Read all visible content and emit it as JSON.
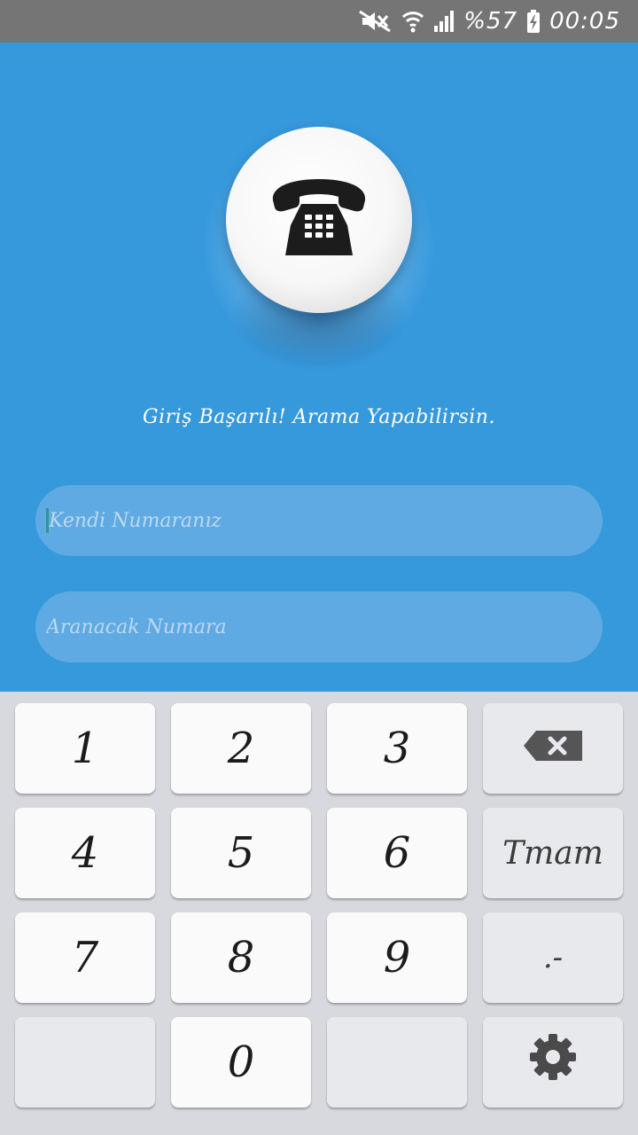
{
  "status_bar": {
    "battery": "%57",
    "time": "00:05",
    "icons": [
      "mute-icon",
      "wifi-icon",
      "signal-icon",
      "battery-charging-icon"
    ]
  },
  "app": {
    "call_icon": "telephone-icon",
    "message": "Giriş Başarılı! Arama Yapabilirsin.",
    "own_number_placeholder": "Kendi Numaranız",
    "target_number_placeholder": "Aranacak Numara"
  },
  "keyboard": {
    "digits": [
      "1",
      "2",
      "3",
      "4",
      "5",
      "6",
      "7",
      "8",
      "9",
      "0"
    ],
    "done_label": "Tmam",
    "punct_label": ".-",
    "backspace_icon": "backspace-icon",
    "settings_icon": "gear-icon"
  },
  "colors": {
    "app_background": "#3699dc",
    "status_bar": "#757575",
    "keyboard_background": "#d7d9de"
  }
}
